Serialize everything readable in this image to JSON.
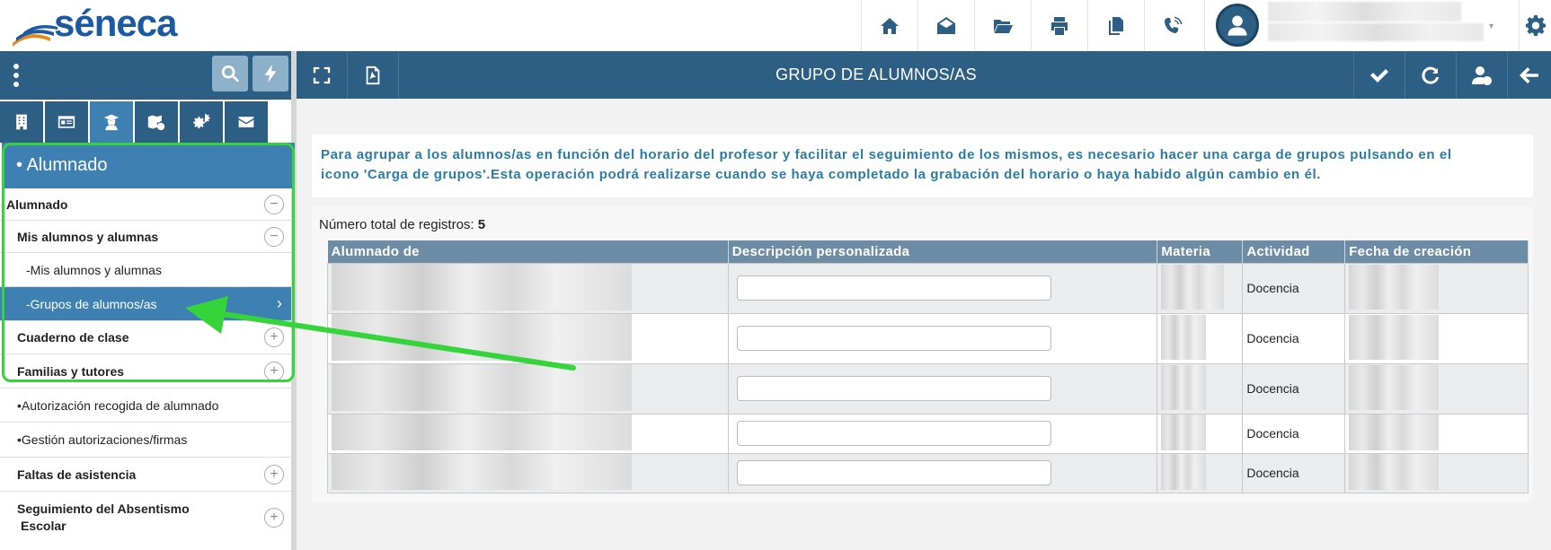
{
  "app": {
    "logo_text": "séneca",
    "title": "GRUPO DE ALUMNOS/AS"
  },
  "topbar": {
    "icons": [
      "home-icon",
      "envelope-open-icon",
      "folder-open-icon",
      "print-icon",
      "documents-icon",
      "phone-volume-icon"
    ],
    "user": {
      "name_hidden": true
    }
  },
  "sidebar": {
    "tabs": [
      "building-icon",
      "id-card-icon",
      "students-icon",
      "map-icon",
      "cogs-icon",
      "mail-icon"
    ],
    "active_tab_index": 2,
    "section_title": "• Alumnado",
    "items": [
      {
        "label": "Alumnado",
        "control": "−",
        "level": 0,
        "bold": true
      },
      {
        "label": "Mis alumnos y alumnas",
        "control": "−",
        "level": 1,
        "bold": true
      },
      {
        "label": "-Mis alumnos y alumnas",
        "control": "",
        "level": 2,
        "bold": false
      },
      {
        "label": "-Grupos de alumnos/as",
        "control": "›",
        "level": 2,
        "bold": false,
        "active": true
      },
      {
        "label": "Cuaderno de clase",
        "control": "+",
        "level": 1,
        "bold": true
      },
      {
        "label": "Familias y tutores",
        "control": "+",
        "level": 1,
        "bold": true
      },
      {
        "label": "•Autorización recogida de alumnado",
        "control": "",
        "level": 1,
        "bold": false
      },
      {
        "label": "•Gestión autorizaciones/firmas",
        "control": "",
        "level": 1,
        "bold": false
      },
      {
        "label": "Faltas de asistencia",
        "control": "+",
        "level": 1,
        "bold": true
      },
      {
        "label": "Seguimiento del Absentismo",
        "label2": "Escolar",
        "control": "+",
        "level": 1,
        "bold": true
      }
    ]
  },
  "content": {
    "info_line1": "Para agrupar a los alumnos/as en función del horario del profesor y facilitar el seguimiento de los mismos, es necesario hacer una carga de grupos pulsando en el",
    "info_line2": "icono 'Carga de grupos'.Esta operación podrá realizarse cuando se haya completado la grabación del horario o haya habido algún cambio en él.",
    "total_label": "Número total de registros:",
    "total_value": "5",
    "columns": [
      "Alumnado de",
      "Descripción personalizada",
      "Materia",
      "Actividad",
      "Fecha de creación"
    ],
    "rows": [
      {
        "actividad": "Docencia",
        "descripcion": ""
      },
      {
        "actividad": "Docencia",
        "descripcion": ""
      },
      {
        "actividad": "Docencia",
        "descripcion": ""
      },
      {
        "actividad": "Docencia",
        "descripcion": ""
      },
      {
        "actividad": "Docencia",
        "descripcion": ""
      }
    ]
  },
  "colors": {
    "primary": "#2d5f84",
    "active": "#3e80b2",
    "info_text": "#2a7ca8",
    "table_header": "#6d8ca6",
    "annotation": "#35d43a"
  }
}
